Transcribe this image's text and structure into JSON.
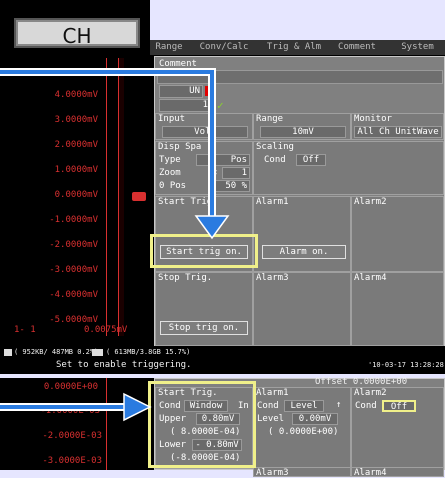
{
  "colors": {
    "highlight": "#f0f08a",
    "arrow": "#2a7be0",
    "waveform": "#d83030",
    "panel": "#808080"
  },
  "screen1": {
    "ch_label": "CH",
    "tabs": [
      "Range",
      "Conv/Calc",
      "Trig & Alm",
      "Comment",
      "System"
    ],
    "y_ticks": [
      "4.0000mV",
      "3.0000mV",
      "2.0000mV",
      "1.0000mV",
      "0.0000mV",
      "-1.0000mV",
      "-2.0000mV",
      "-3.0000mV",
      "-4.0000mV",
      "-5.0000mV"
    ],
    "trace_label": "1- 1",
    "trace_value": "0.0075mV",
    "comment_label": "Comment",
    "unit_label": "UN",
    "unit_value": "1",
    "input": {
      "label": "Input",
      "value": "Volt"
    },
    "range": {
      "label": "Range",
      "value": "10mV"
    },
    "monitor": {
      "label": "Monitor",
      "value": "All Ch UnitWave"
    },
    "disp": {
      "label": "Disp Spa",
      "type_label": "Type",
      "type_value": "Pos",
      "zoom_label": "Zoom",
      "zoom_x": "×",
      "zoom_value": "1",
      "pos_label": "0 Pos",
      "pos_value": "50 %"
    },
    "scaling": {
      "label": "Scaling",
      "cond_label": "Cond",
      "cond_value": "Off"
    },
    "start_trig": {
      "label": "Start Trig.",
      "button": "Start trig on."
    },
    "alarm1": {
      "label": "Alarm1",
      "button": "Alarm on."
    },
    "alarm2": {
      "label": "Alarm2"
    },
    "stop_trig": {
      "label": "Stop Trig.",
      "button": "Stop trig on."
    },
    "alarm3": {
      "label": "Alarm3"
    },
    "alarm4": {
      "label": "Alarm4"
    },
    "status_cf": "( 952KB/ 487MB 0.2%)",
    "status_usb": "( 613MB/3.8GB 15.7%)",
    "hint": "Set to enable triggering.",
    "datetime": "'10-03-17 13:28:28"
  },
  "screen2": {
    "y_ticks": [
      "0.0000E+00",
      "-1.0000E-03",
      "-2.0000E-03",
      "-3.0000E-03"
    ],
    "offset_text": "Offset 0.0000E+00",
    "start_trig": {
      "label": "Start Trig.",
      "cond_label": "Cond",
      "cond_value": "Window",
      "cond_in": "In",
      "upper_label": "Upper",
      "upper_value": "0.80mV",
      "upper_sci": "( 8.0000E-04)",
      "lower_label": "Lower",
      "lower_value": "- 0.80mV",
      "lower_sci": "(-8.0000E-04)"
    },
    "alarm1": {
      "label": "Alarm1",
      "cond_label": "Cond",
      "cond_value": "Level",
      "arrow": "↑",
      "level_label": "Level",
      "level_value": "0.00mV",
      "level_sci": "( 0.0000E+00)"
    },
    "alarm2": {
      "label": "Alarm2",
      "cond_label": "Cond",
      "cond_value": "Off"
    },
    "alarm3": {
      "label": "Alarm3"
    },
    "alarm4": {
      "label": "Alarm4"
    }
  }
}
